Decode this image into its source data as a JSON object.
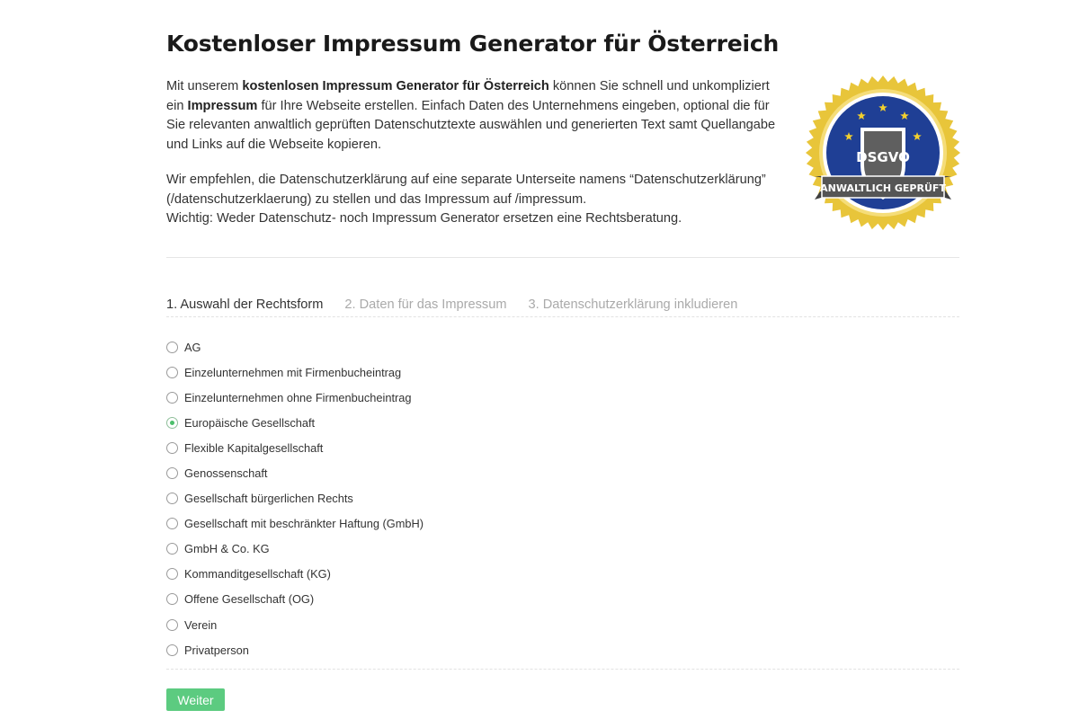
{
  "page": {
    "title": "Kostenloser Impressum Generator für Österreich"
  },
  "intro": {
    "p1_a": "Mit unserem ",
    "p1_b": "kostenlosen Impressum Generator für Österreich",
    "p1_c": " können Sie schnell und unkompliziert ein ",
    "p1_d": "Impressum",
    "p1_e": " für Ihre Webseite erstellen. Einfach Daten des Unternehmens eingeben, optional die für Sie relevanten anwaltlich geprüften Datenschutztexte auswählen und generierten Text samt Quellangabe und Links auf die Webseite kopieren.",
    "p2_line1": "Wir empfehlen, die Datenschutzerklärung auf eine separate Unterseite namens “Datenschutzerklärung” (/datenschutzerklaerung) zu stellen und das Impressum auf /impressum.",
    "p2_line2": "Wichtig: Weder Datenschutz- noch Impressum Generator ersetzen eine Rechtsberatung."
  },
  "badge": {
    "shield_text": "DSGVO",
    "ribbon_text": "ANWALTLICH GEPRÜFT",
    "colors": {
      "gold": "#e8c53a",
      "blue": "#1f3f95",
      "star": "#f2cf2e",
      "shield": "#5f5f5f",
      "ribbon": "#555555"
    }
  },
  "tabs": [
    {
      "label": "1. Auswahl der Rechtsform",
      "active": true
    },
    {
      "label": "2. Daten für das Impressum",
      "active": false
    },
    {
      "label": "3. Datenschutzerklärung inkludieren",
      "active": false
    }
  ],
  "legal_forms": {
    "selected": "Europäische Gesellschaft",
    "options": [
      "AG",
      "Einzelunternehmen mit Firmenbucheintrag",
      "Einzelunternehmen ohne Firmenbucheintrag",
      "Europäische Gesellschaft",
      "Flexible Kapitalgesellschaft",
      "Genossenschaft",
      "Gesellschaft bürgerlichen Rechts",
      "Gesellschaft mit beschränkter Haftung (GmbH)",
      "GmbH & Co. KG",
      "Kommanditgesellschaft (KG)",
      "Offene Gesellschaft (OG)",
      "Verein",
      "Privatperson"
    ]
  },
  "actions": {
    "next_label": "Weiter",
    "accent": "#5ccb80"
  }
}
